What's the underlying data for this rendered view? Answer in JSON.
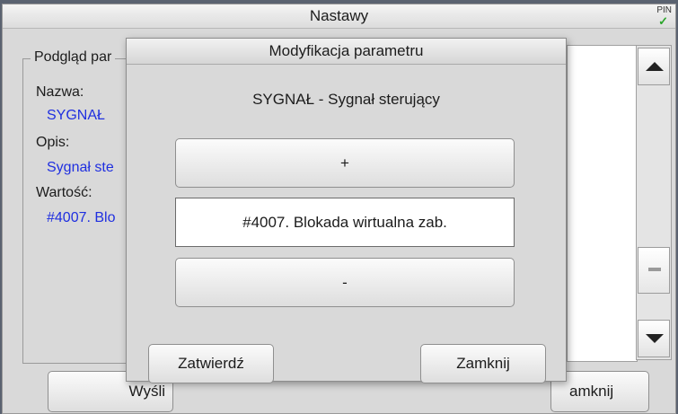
{
  "main_window": {
    "title": "Nastawy",
    "pin_label": "PIN",
    "pin_check": "✓"
  },
  "preview": {
    "legend": "Podgląd par",
    "name_label": "Nazwa:",
    "name_value": "SYGNAŁ",
    "desc_label": "Opis:",
    "desc_value": "Sygnał ste",
    "value_label": "Wartość:",
    "value_value": "#4007. Blo"
  },
  "bottom_buttons": {
    "send_label": "Wyśli",
    "close_label": "amknij"
  },
  "dialog": {
    "title": "Modyfikacja parametru",
    "subtitle": "SYGNAŁ - Sygnał sterujący",
    "plus_label": "+",
    "current_value": "#4007. Blokada wirtualna zab.",
    "minus_label": "-",
    "confirm_label": "Zatwierdź",
    "close_label": "Zamknij"
  },
  "colors": {
    "value_text": "#1f2fe0",
    "window_bg": "#d9d9d9",
    "pin_check": "#2aa52a"
  },
  "icons": {
    "scroll_up": "triangle-up-icon",
    "scroll_down": "triangle-down-icon",
    "pin_status": "checkmark-icon"
  }
}
